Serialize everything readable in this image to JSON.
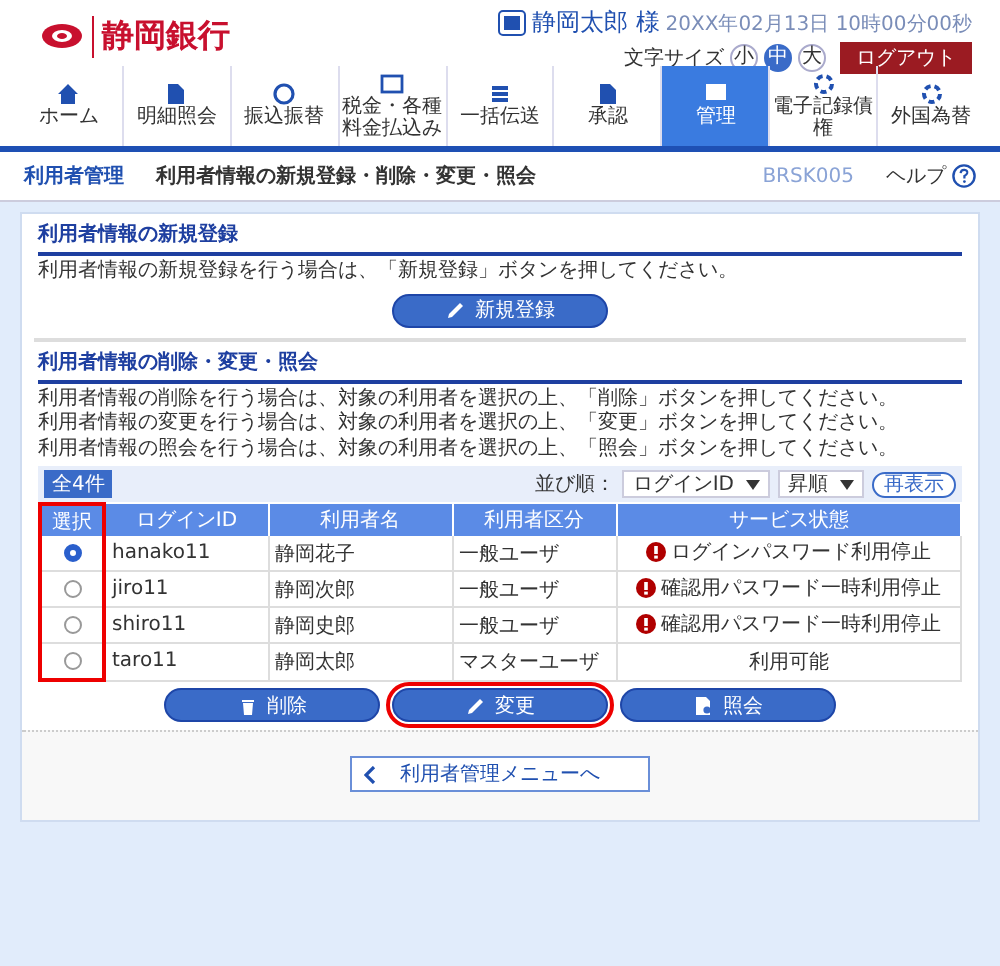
{
  "header": {
    "bank_name": "静岡銀行",
    "user_name": "静岡太郎 様",
    "datetime": "20XX年02月13日 10時00分00秒",
    "font_size_label": "文字サイズ",
    "font_sizes": [
      {
        "label": "小",
        "selected": false
      },
      {
        "label": "中",
        "selected": true
      },
      {
        "label": "大",
        "selected": false
      }
    ],
    "logout": "ログアウト"
  },
  "nav": [
    {
      "label": "ホーム",
      "selected": false
    },
    {
      "label": "明細照会",
      "selected": false
    },
    {
      "label": "振込振替",
      "selected": false
    },
    {
      "label": "税金・各種料金払込み",
      "selected": false
    },
    {
      "label": "一括伝送",
      "selected": false
    },
    {
      "label": "承認",
      "selected": false
    },
    {
      "label": "管理",
      "selected": true
    },
    {
      "label": "電子記録債権",
      "selected": false
    },
    {
      "label": "外国為替",
      "selected": false
    }
  ],
  "title_bar": {
    "section": "利用者管理",
    "title": "利用者情報の新規登録・削除・変更・照会",
    "screen_id": "BRSK005",
    "help": "ヘルプ"
  },
  "new_section": {
    "title": "利用者情報の新規登録",
    "description": "利用者情報の新規登録を行う場合は、「新規登録」ボタンを押してください。",
    "button": "新規登録"
  },
  "manage_section": {
    "title": "利用者情報の削除・変更・照会",
    "descriptions": [
      "利用者情報の削除を行う場合は、対象の利用者を選択の上、「削除」ボタンを押してください。",
      "利用者情報の変更を行う場合は、対象の利用者を選択の上、「変更」ボタンを押してください。",
      "利用者情報の照会を行う場合は、対象の利用者を選択の上、「照会」ボタンを押してください。"
    ],
    "total": "全4件",
    "sort_label": "並び順：",
    "sort_field": "ログインID",
    "sort_order": "昇順",
    "refresh": "再表示",
    "table": {
      "columns": [
        {
          "label": "選択",
          "highlighted": true
        },
        {
          "label": "ログインID",
          "highlighted": false
        },
        {
          "label": "利用者名",
          "highlighted": false
        },
        {
          "label": "利用者区分",
          "highlighted": false
        },
        {
          "label": "サービス状態",
          "highlighted": false
        }
      ],
      "rows": [
        {
          "selected": true,
          "login_id": "hanako11",
          "name": "静岡花子",
          "type": "一般ユーザ",
          "status": "ログインパスワード利用停止",
          "warning": true
        },
        {
          "selected": false,
          "login_id": "jiro11",
          "name": "静岡次郎",
          "type": "一般ユーザ",
          "status": "確認用パスワード一時利用停止",
          "warning": true
        },
        {
          "selected": false,
          "login_id": "shiro11",
          "name": "静岡史郎",
          "type": "一般ユーザ",
          "status": "確認用パスワード一時利用停止",
          "warning": true
        },
        {
          "selected": false,
          "login_id": "taro11",
          "name": "静岡太郎",
          "type": "マスターユーザ",
          "status": "利用可能",
          "warning": false
        }
      ]
    },
    "buttons": [
      {
        "kind": "delete",
        "label": "削除",
        "highlighted": false
      },
      {
        "kind": "edit",
        "label": "変更",
        "highlighted": true
      },
      {
        "kind": "view",
        "label": "照会",
        "highlighted": false
      }
    ]
  },
  "back_button": "利用者管理メニューへ"
}
